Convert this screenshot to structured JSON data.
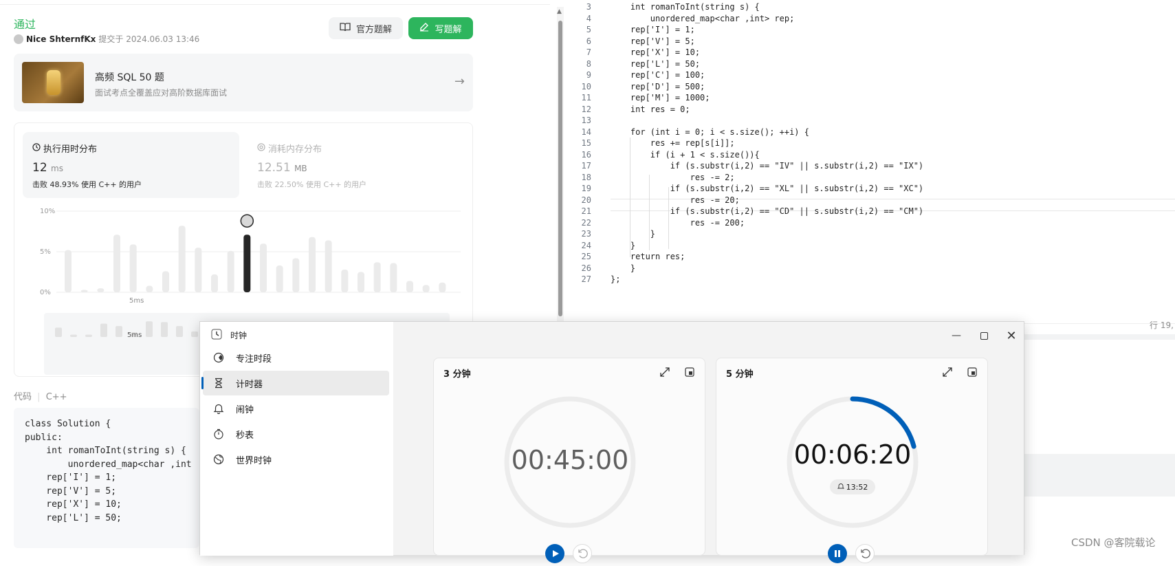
{
  "submission": {
    "status": "通过",
    "user": "Nice ShternfKx",
    "submitted_at": "提交于 2024.06.03 13:46",
    "btn_official": "官方题解",
    "btn_write": "写题解"
  },
  "course": {
    "title": "高频 SQL 50 题",
    "subtitle": "面试考点全覆盖应对高阶数据库面试"
  },
  "runtime": {
    "title": "执行用时分布",
    "value": "12",
    "unit": "ms",
    "beat_prefix": "击败",
    "beat_pct": "48.93%",
    "beat_suffix": "使用 C++ 的用户"
  },
  "memory": {
    "title": "消耗内存分布",
    "value": "12.51",
    "unit": "MB",
    "beat_prefix": "击败",
    "beat_pct": "22.50%",
    "beat_suffix": "使用 C++ 的用户"
  },
  "chart_data": {
    "type": "bar",
    "title": "执行用时分布",
    "yticks": [
      "10%",
      "5%",
      "0%"
    ],
    "ylim": [
      0,
      10
    ],
    "xtick_label": "5ms",
    "highlight_index": 11,
    "values": [
      5.2,
      0.3,
      0.5,
      7.1,
      5.9,
      0.8,
      2.6,
      8.2,
      5.5,
      2.2,
      5.1,
      7.1,
      6.0,
      3.3,
      4.2,
      6.8,
      6.4,
      2.8,
      2.5,
      3.7,
      3.6,
      1.4,
      0.9,
      1.2
    ],
    "minimap_values": [
      1.2,
      0.3,
      0.3,
      1.7,
      1.4,
      0.6,
      2.0,
      1.9,
      1.4,
      0.7
    ],
    "minimap_xtick_label": "5ms"
  },
  "code_panel": {
    "label": "代码",
    "lang": "C++",
    "lines": [
      "class Solution {",
      "public:",
      "    int romanToInt(string s) {",
      "        unordered_map<char ,int",
      "    rep['I'] = 1;",
      "    rep['V'] = 5;",
      "    rep['X'] = 10;",
      "    rep['L'] = 50;"
    ]
  },
  "editor": {
    "lines": [
      {
        "n": "3",
        "code": "    int romanToInt(string s) {"
      },
      {
        "n": "4",
        "code": "        unordered_map<char ,int> rep;"
      },
      {
        "n": "5",
        "code": "    rep['I'] = 1;"
      },
      {
        "n": "6",
        "code": "    rep['V'] = 5;"
      },
      {
        "n": "7",
        "code": "    rep['X'] = 10;"
      },
      {
        "n": "8",
        "code": "    rep['L'] = 50;"
      },
      {
        "n": "9",
        "code": "    rep['C'] = 100;"
      },
      {
        "n": "10",
        "code": "    rep['D'] = 500;"
      },
      {
        "n": "11",
        "code": "    rep['M'] = 1000;"
      },
      {
        "n": "12",
        "code": "    int res = 0;"
      },
      {
        "n": "13",
        "code": ""
      },
      {
        "n": "14",
        "code": "    for (int i = 0; i < s.size(); ++i) {"
      },
      {
        "n": "15",
        "code": "        res += rep[s[i]];"
      },
      {
        "n": "16",
        "code": "        if (i + 1 < s.size()){"
      },
      {
        "n": "17",
        "code": "            if (s.substr(i,2) == \"IV\" || s.substr(i,2) == \"IX\")"
      },
      {
        "n": "18",
        "code": "                res -= 2;"
      },
      {
        "n": "19",
        "code": "            if (s.substr(i,2) == \"XL\" || s.substr(i,2) == \"XC\")"
      },
      {
        "n": "20",
        "code": "                res -= 20;"
      },
      {
        "n": "21",
        "code": "            if (s.substr(i,2) == \"CD\" || s.substr(i,2) == \"CM\")"
      },
      {
        "n": "22",
        "code": "                res -= 200;"
      },
      {
        "n": "23",
        "code": "        }"
      },
      {
        "n": "24",
        "code": "    }"
      },
      {
        "n": "25",
        "code": "    return res;"
      },
      {
        "n": "26",
        "code": "    }"
      },
      {
        "n": "27",
        "code": "};"
      }
    ],
    "row_status": "行 19,",
    "watermark": "CSDN @客院载论"
  },
  "clock_app": {
    "app_title": "时钟",
    "nav": [
      {
        "label": "专注时段",
        "icon": "focus-icon"
      },
      {
        "label": "计时器",
        "icon": "hourglass-icon",
        "selected": true
      },
      {
        "label": "闹钟",
        "icon": "bell-icon"
      },
      {
        "label": "秒表",
        "icon": "stopwatch-icon"
      },
      {
        "label": "世界时钟",
        "icon": "globe-icon"
      }
    ],
    "timers": [
      {
        "title": "3 分钟",
        "time": "00:45:00",
        "running": false,
        "progress": 0
      },
      {
        "title": "5 分钟",
        "time": "00:06:20",
        "running": true,
        "progress": 0.21,
        "alarm": "13:52"
      }
    ],
    "accent": "#005fb8"
  }
}
